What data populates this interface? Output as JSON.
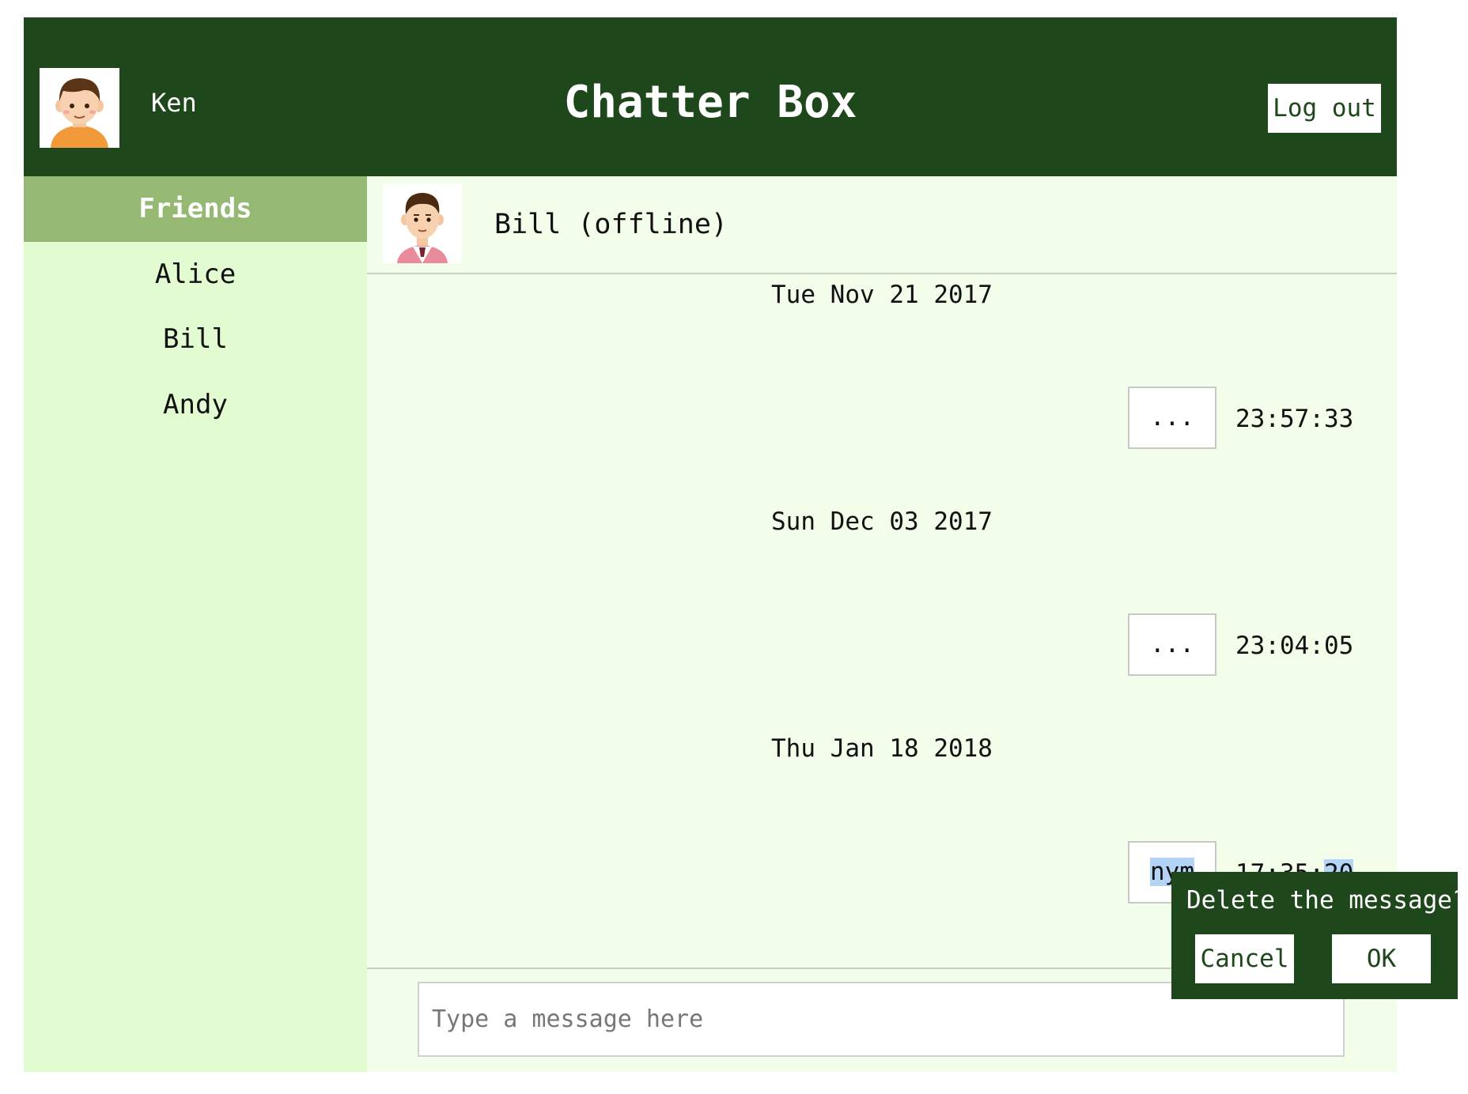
{
  "header": {
    "username": "Ken",
    "title": "Chatter Box",
    "logout_label": "Log out",
    "self_avatar_icon": "boy-avatar-icon"
  },
  "sidebar": {
    "heading": "Friends",
    "friends": [
      {
        "name": "Alice"
      },
      {
        "name": "Bill"
      },
      {
        "name": "Andy"
      }
    ]
  },
  "chat": {
    "friend_status": "Bill (offline)",
    "friend_avatar_icon": "man-avatar-icon",
    "groups": [
      {
        "date": "Tue Nov 21 2017",
        "message": "...",
        "time": "23:57:33"
      },
      {
        "date": "Sun Dec 03 2017",
        "message": "...",
        "time": "23:04:05"
      },
      {
        "date": "Thu Jan 18 2018",
        "message": "nym",
        "time_prefix": "17:35:",
        "time_selected": "20"
      }
    ],
    "input": {
      "placeholder": "Type a message here",
      "value": ""
    }
  },
  "confirm_dialog": {
    "text": "Delete the message?",
    "cancel_label": "Cancel",
    "ok_label": "OK"
  },
  "colors": {
    "header_bg": "#1e471b",
    "sidebar_bg": "#e3fbd0",
    "sidebar_heading_bg": "#95b872",
    "chat_bg": "#f2fdea",
    "selection": "#b4d4f7"
  }
}
